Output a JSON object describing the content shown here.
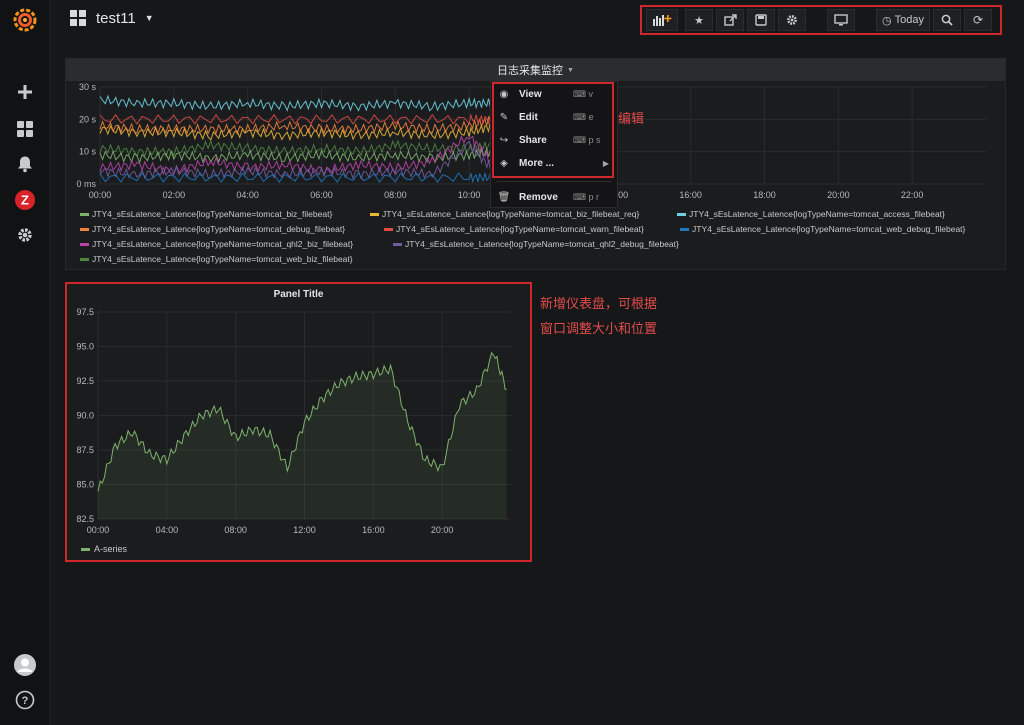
{
  "topbar": {
    "dashboard_title": "test11",
    "toolbar": {
      "buttons": [
        "add-panel",
        "star",
        "share",
        "save",
        "settings",
        "tv-mode",
        "time-picker",
        "zoom-out",
        "refresh"
      ],
      "time_label": "Today"
    }
  },
  "sidebar": {
    "items": [
      "grafana-logo",
      "plus",
      "dashboards",
      "alerting",
      "zabbix",
      "settings",
      "profile",
      "help"
    ],
    "zabbix_letter": "Z"
  },
  "panel1": {
    "title": "日志采集监控",
    "menu": [
      {
        "label": "View",
        "shortcut": "v",
        "icon": "eye-icon"
      },
      {
        "label": "Edit",
        "shortcut": "e",
        "icon": "edit-icon"
      },
      {
        "label": "Share",
        "shortcut": "p s",
        "icon": "share-icon"
      },
      {
        "label": "More ...",
        "shortcut": "",
        "icon": "cube-icon"
      },
      {
        "label": "Remove",
        "shortcut": "p r",
        "icon": "trash-icon"
      }
    ],
    "legend": [
      {
        "label": "JTY4_sEsLatence_Latence{logTypeName=tomcat_biz_filebeat}",
        "color": "#7eb26d"
      },
      {
        "label": "JTY4_sEsLatence_Latence{logTypeName=tomcat_biz_filebeat_req}",
        "color": "#eab839"
      },
      {
        "label": "JTY4_sEsLatence_Latence{logTypeName=tomcat_access_filebeat}",
        "color": "#6ed0e0"
      },
      {
        "label": "JTY4_sEsLatence_Latence{logTypeName=tomcat_debug_filebeat}",
        "color": "#ef843c"
      },
      {
        "label": "JTY4_sEsLatence_Latence{logTypeName=tomcat_warn_filebeat}",
        "color": "#e24d42"
      },
      {
        "label": "JTY4_sEsLatence_Latence{logTypeName=tomcat_web_debug_filebeat}",
        "color": "#1f78c1"
      },
      {
        "label": "JTY4_sEsLatence_Latence{logTypeName=tomcat_qhl2_biz_filebeat}",
        "color": "#ba43a9"
      },
      {
        "label": "JTY4_sEsLatence_Latence{logTypeName=tomcat_qhl2_debug_filebeat}",
        "color": "#705da0"
      },
      {
        "label": "JTY4_sEsLatence_Latence{logTypeName=tomcat_web_biz_filebeat}",
        "color": "#508642"
      }
    ]
  },
  "annotations": {
    "edit_note": "编辑",
    "new_panel_note_line1": "新增仪表盘，可根据",
    "new_panel_note_line2": "窗口调整大小和位置"
  },
  "panel2": {
    "title": "Panel Title",
    "legend": "A-series"
  },
  "chart_data": [
    {
      "type": "line",
      "y_ticks": [
        "0 ms",
        "10 s",
        "20 s",
        "30 s"
      ],
      "x_ticks": [
        "00:00",
        "02:00",
        "04:00",
        "06:00",
        "08:00",
        "10:00",
        "12:00",
        "14:00",
        "16:00",
        "18:00",
        "20:00",
        "22:00"
      ],
      "ylim": [
        0,
        30
      ],
      "grid": true,
      "series": [
        {
          "name": "JTY4_sEsLatence_Latence{logTypeName=tomcat_access_filebeat}",
          "color": "#6ed0e0",
          "x": [
            "00:00",
            "01:00",
            "02:00",
            "03:00",
            "04:00",
            "05:00",
            "06:00",
            "07:00",
            "08:00",
            "09:00",
            "10:00",
            "10:40"
          ],
          "y": [
            26,
            25,
            25,
            24,
            25,
            24,
            25,
            24,
            25,
            24,
            25,
            25
          ]
        },
        {
          "name": "JTY4_sEsLatence_Latence{logTypeName=tomcat_biz_filebeat_req}",
          "color": "#eab839",
          "x": [
            "00:00",
            "01:00",
            "02:00",
            "03:00",
            "04:00",
            "05:00",
            "06:00",
            "07:00",
            "08:00",
            "09:00",
            "10:00",
            "10:40"
          ],
          "y": [
            17,
            16,
            16,
            15,
            16,
            15,
            16,
            15,
            16,
            15,
            16,
            18
          ]
        },
        {
          "name": "JTY4_sEsLatence_Latence{logTypeName=tomcat_debug_filebeat}",
          "color": "#ef843c",
          "x": [
            "00:00",
            "01:00",
            "02:00",
            "03:00",
            "04:00",
            "05:00",
            "06:00",
            "07:00",
            "08:00",
            "09:00",
            "10:00",
            "10:40"
          ],
          "y": [
            18,
            17,
            17,
            17,
            17,
            18,
            17,
            17,
            18,
            17,
            18,
            20
          ]
        },
        {
          "name": "JTY4_sEsLatence_Latence{logTypeName=tomcat_web_biz_filebeat}",
          "color": "#508642",
          "x": [
            "00:00",
            "01:00",
            "02:00",
            "03:00",
            "04:00",
            "05:00",
            "06:00",
            "07:00",
            "08:00",
            "09:00",
            "10:00",
            "10:40"
          ],
          "y": [
            11,
            10,
            10,
            12,
            11,
            10,
            11,
            10,
            12,
            11,
            11,
            12
          ]
        },
        {
          "name": "JTY4_sEsLatence_Latence{logTypeName=tomcat_biz_filebeat}",
          "color": "#7eb26d",
          "x": [
            "00:00",
            "01:00",
            "02:00",
            "03:00",
            "04:00",
            "05:00",
            "06:00",
            "07:00",
            "08:00",
            "09:00",
            "10:00",
            "10:40"
          ],
          "y": [
            9,
            8,
            9,
            8,
            9,
            8,
            9,
            8,
            9,
            8,
            9,
            10
          ]
        },
        {
          "name": "JTY4_sEsLatence_Latence{logTypeName=tomcat_warn_filebeat}",
          "color": "#e24d42",
          "x": [
            "00:00",
            "02:00",
            "04:00",
            "06:00",
            "08:00",
            "10:00",
            "10:40"
          ],
          "y": [
            20,
            20,
            20,
            20,
            20,
            20,
            20
          ]
        },
        {
          "name": "JTY4_sEsLatence_Latence{logTypeName=tomcat_qhl2_biz_filebeat}",
          "color": "#ba43a9",
          "x": [
            "00:00",
            "01:00",
            "02:00",
            "03:00",
            "04:00",
            "05:00",
            "06:00",
            "07:00",
            "08:00",
            "09:00",
            "10:00",
            "10:40"
          ],
          "y": [
            5,
            6,
            4,
            7,
            5,
            6,
            4,
            6,
            5,
            7,
            15,
            6
          ]
        },
        {
          "name": "JTY4_sEsLatence_Latence{logTypeName=tomcat_qhl2_debug_filebeat}",
          "color": "#705da0",
          "x": [
            "00:00",
            "01:00",
            "02:00",
            "03:00",
            "04:00",
            "05:00",
            "06:00",
            "07:00",
            "08:00",
            "09:00",
            "10:00",
            "10:40"
          ],
          "y": [
            4,
            3,
            4,
            3,
            4,
            3,
            4,
            3,
            4,
            3,
            12,
            4
          ]
        },
        {
          "name": "JTY4_sEsLatence_Latence{logTypeName=tomcat_web_debug_filebeat}",
          "color": "#1f78c1",
          "x": [
            "00:00",
            "02:00",
            "04:00",
            "06:00",
            "08:00",
            "10:00",
            "10:40"
          ],
          "y": [
            2,
            2,
            2,
            2,
            2,
            2,
            2
          ]
        }
      ]
    },
    {
      "type": "area",
      "title": "Panel Title",
      "x_ticks": [
        "00:00",
        "04:00",
        "08:00",
        "12:00",
        "16:00",
        "20:00"
      ],
      "y_ticks": [
        "82.5",
        "85.0",
        "87.5",
        "90.0",
        "92.5",
        "95.0",
        "97.5"
      ],
      "ylim": [
        82.5,
        97.5
      ],
      "grid": true,
      "series": [
        {
          "name": "A-series",
          "color": "#7eb26d",
          "x": [
            "00:00",
            "01:00",
            "02:00",
            "03:00",
            "04:00",
            "05:00",
            "06:00",
            "07:00",
            "08:00",
            "09:00",
            "10:00",
            "11:00",
            "12:00",
            "13:00",
            "14:00",
            "15:00",
            "16:00",
            "17:00",
            "18:00",
            "19:00",
            "20:00",
            "21:00",
            "22:00",
            "23:00",
            "23:45"
          ],
          "y": [
            84.5,
            87.8,
            88.8,
            87.2,
            86.8,
            88.5,
            90.0,
            90.5,
            88.4,
            89.0,
            88.6,
            86.2,
            89.5,
            91.2,
            92.3,
            92.8,
            93.0,
            93.4,
            89.6,
            86.8,
            86.2,
            90.8,
            91.8,
            94.6,
            91.9
          ]
        }
      ]
    }
  ]
}
